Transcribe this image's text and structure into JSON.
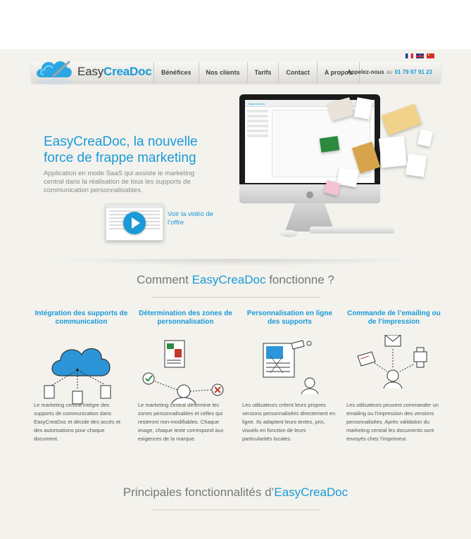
{
  "brand": {
    "easy": "Easy",
    "crea": "CreaDoc"
  },
  "languages": [
    "fr",
    "en",
    "cn"
  ],
  "nav": {
    "items": [
      {
        "label": "Bénéfices"
      },
      {
        "label": "Nos clients"
      },
      {
        "label": "Tarifs"
      },
      {
        "label": "Contact"
      },
      {
        "label": "A propos"
      }
    ]
  },
  "phone": {
    "prefix": "Appelez-nous",
    "ou": "au",
    "number": "01 79 97 91 23"
  },
  "hero": {
    "title": "EasyCreaDoc, la nouvelle force de frappe marketing",
    "description": "Application en mode SaaS qui assiste le marketing central dans la réalisation de tous les supports de communication personnalisables.",
    "video_link": "Voir la vidéo de l’offre",
    "screen_logo": "EasyCreaDoc"
  },
  "how": {
    "title_prefix": "Comment ",
    "title_brand": "EasyCreaDoc",
    "title_suffix": " fonctionne ?"
  },
  "columns": [
    {
      "heading": "Intégration des supports de communication",
      "text": "Le marketing central intègre des supports de communication dans EasyCreaDoc et décide des accès et des autorisations pour chaque document."
    },
    {
      "heading": "Détermination des zones de personnalisation",
      "text": "Le marketing central détermine les zones personnalisables et celles qui resteront non-modifiables. Chaque image, chaque texte correspond aux exigences de la marque."
    },
    {
      "heading": "Personnalisation en ligne des supports",
      "text": "Les utilisateurs créent leurs propres versions personnalisées directement en ligne. Ils adaptent leurs textes, prix, visuels en fonction de leurs particularités locales."
    },
    {
      "heading": "Commande de l’emailing ou de l’impression",
      "text": "Les utilisateurs peuvent commander un emailing ou l’impression des versions personnalisées. Après validation du marketing central les documents sont envoyés chez l’imprimeur."
    }
  ],
  "features": {
    "title_prefix": "Principales fonctionnalités d’",
    "title_brand": "EasyCreaDoc"
  },
  "colors": {
    "accent": "#1a9ad6",
    "background": "#f3f2ed",
    "text": "#555555"
  }
}
